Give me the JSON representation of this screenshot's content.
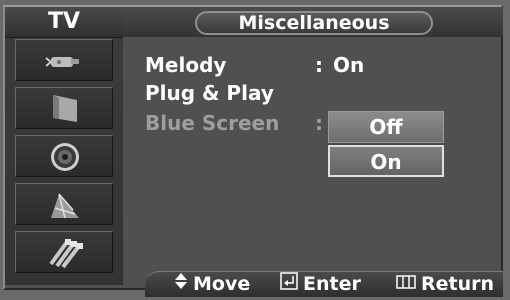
{
  "sidebar": {
    "title": "TV",
    "icons": [
      "input-source-icon",
      "picture-icon",
      "sound-icon",
      "channel-antenna-icon",
      "setup-connectors-icon"
    ]
  },
  "header": {
    "title": "Miscellaneous"
  },
  "menu": {
    "items": [
      {
        "label": "Melody",
        "separator": ":",
        "value": "On"
      },
      {
        "label": "Plug & Play"
      },
      {
        "label": "Blue Screen",
        "separator": ":"
      }
    ],
    "dropdown": {
      "options": [
        "Off",
        "On"
      ],
      "highlighted": "Off"
    }
  },
  "footer": {
    "move": "Move",
    "enter": "Enter",
    "return": "Return"
  },
  "colors": {
    "background": "#505050",
    "dim_text": "#9e9e9e",
    "text": "#ffffff"
  }
}
